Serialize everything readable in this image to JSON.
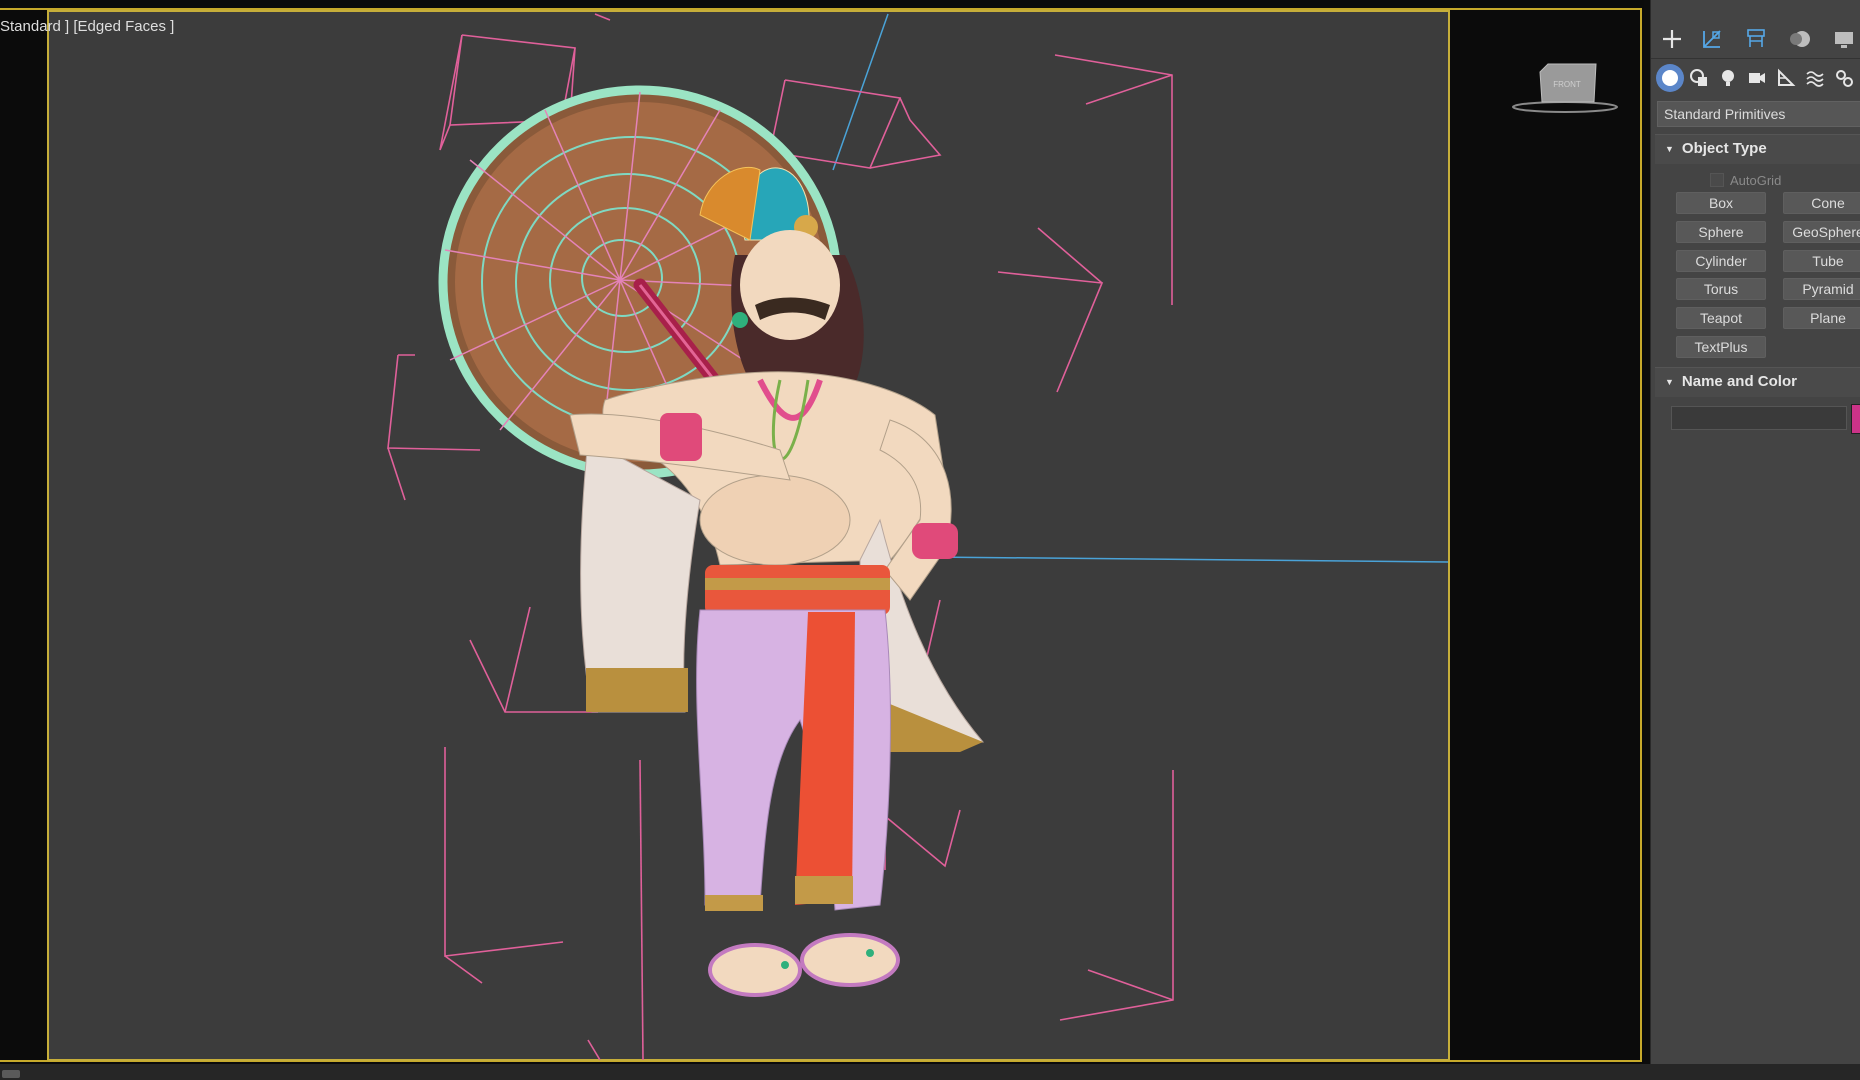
{
  "viewport": {
    "label": "Standard ] [Edged Faces ]",
    "viewcube_face": "FRONT"
  },
  "command_panel": {
    "main_tabs": [
      "create-icon",
      "modify-icon",
      "hierarchy-icon",
      "motion-icon",
      "display-icon"
    ],
    "create_tabs": [
      "geometry-icon",
      "shapes-icon",
      "lights-icon",
      "cameras-icon",
      "helpers-icon",
      "space-warps-icon",
      "systems-icon"
    ],
    "category": "Standard Primitives",
    "object_type": {
      "title": "Object Type",
      "autogrid_label": "AutoGrid",
      "buttons": [
        "Box",
        "Cone",
        "Sphere",
        "GeoSphere",
        "Cylinder",
        "Tube",
        "Torus",
        "Pyramid",
        "Teapot",
        "Plane",
        "TextPlus"
      ]
    },
    "name_and_color": {
      "title": "Name and Color",
      "name_value": "",
      "swatch_color": "#cc3388"
    }
  },
  "colors": {
    "selection_border": "#c7aa2b",
    "viewport_bg": "#3c3c3c",
    "active_tab": "#5b86c9",
    "helper_lines": "#e0609a",
    "axis_line": "#4aa3d8"
  }
}
